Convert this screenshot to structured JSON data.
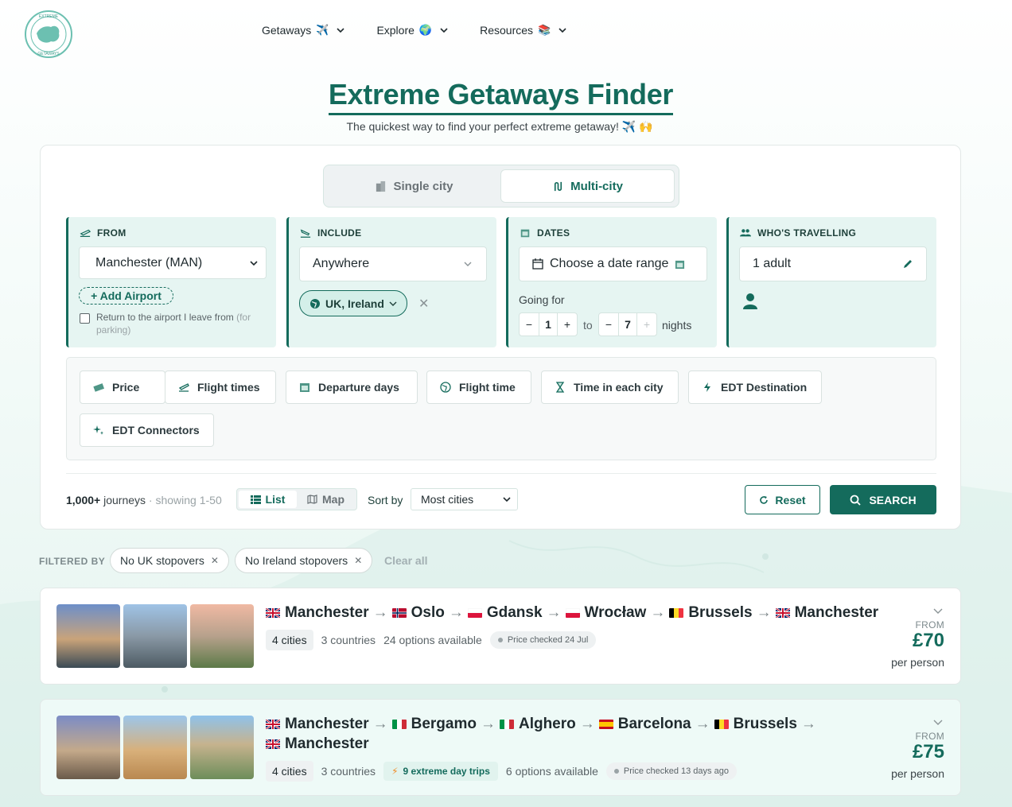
{
  "brand": {
    "logo_text_top": "EXTREME",
    "logo_text_bottom": "GETAWAYS"
  },
  "nav": [
    {
      "label": "Getaways",
      "emoji": "✈️"
    },
    {
      "label": "Explore",
      "emoji": "🌍"
    },
    {
      "label": "Resources",
      "emoji": "📚"
    }
  ],
  "hero": {
    "title": "Extreme Getaways Finder",
    "subtitle": "The quickest way to find your perfect extreme getaway! ✈️ 🙌"
  },
  "mode": {
    "single": "Single city",
    "multi": "Multi-city",
    "active": "multi"
  },
  "from": {
    "label": "FROM",
    "value": "Manchester (MAN)",
    "add_airport": "+ Add Airport",
    "return_label": "Return to the airport I leave from",
    "return_note": "(for parking)"
  },
  "include": {
    "label": "INCLUDE",
    "value": "Anywhere",
    "region": "UK, Ireland"
  },
  "dates": {
    "label": "DATES",
    "value": "Choose a date range",
    "going_for": "Going for",
    "min": "1",
    "to": "to",
    "max": "7",
    "nights": "nights"
  },
  "travellers": {
    "label": "WHO'S TRAVELLING",
    "value": "1 adult"
  },
  "filters": [
    {
      "label": "Price",
      "icon": "money-icon"
    },
    {
      "label": "Flight times",
      "icon": "plane-icon"
    },
    {
      "label": "Departure days",
      "icon": "calendar-icon"
    },
    {
      "label": "Flight time",
      "icon": "globe-icon"
    },
    {
      "label": "Time in each city",
      "icon": "hourglass-icon"
    },
    {
      "label": "EDT Destination",
      "icon": "bolt-icon"
    },
    {
      "label": "EDT Connectors",
      "icon": "sparkle-icon"
    }
  ],
  "results_bar": {
    "count": "1,000+",
    "journeys": "journeys",
    "showing": "· showing 1-50",
    "list": "List",
    "map": "Map",
    "sort_label": "Sort by",
    "sort_value": "Most cities",
    "reset": "Reset",
    "search": "SEARCH"
  },
  "filtered_by": {
    "label": "FILTERED BY",
    "chips": [
      "No UK stopovers",
      "No Ireland stopovers"
    ],
    "clear": "Clear all"
  },
  "results": [
    {
      "stops": [
        {
          "city": "Manchester",
          "flag": "gb"
        },
        {
          "city": "Oslo",
          "flag": "no"
        },
        {
          "city": "Gdansk",
          "flag": "pl"
        },
        {
          "city": "Wrocław",
          "flag": "pl"
        },
        {
          "city": "Brussels",
          "flag": "be"
        },
        {
          "city": "Manchester",
          "flag": "gb"
        }
      ],
      "cities": "4 cities",
      "countries": "3 countries",
      "day_trips": "",
      "options": "24 options available",
      "checked": "Price checked 24 Jul",
      "from": "FROM",
      "price": "£70",
      "per": "per person"
    },
    {
      "stops": [
        {
          "city": "Manchester",
          "flag": "gb"
        },
        {
          "city": "Bergamo",
          "flag": "it"
        },
        {
          "city": "Alghero",
          "flag": "it"
        },
        {
          "city": "Barcelona",
          "flag": "es"
        },
        {
          "city": "Brussels",
          "flag": "be"
        },
        {
          "city": "Manchester",
          "flag": "gb"
        }
      ],
      "cities": "4 cities",
      "countries": "3 countries",
      "day_trips": "9 extreme day trips",
      "options": "6 options available",
      "checked": "Price checked 13 days ago",
      "from": "FROM",
      "price": "£75",
      "per": "per person"
    }
  ],
  "colors": {
    "brand": "#146b5c",
    "panel": "#e6f5f2"
  }
}
